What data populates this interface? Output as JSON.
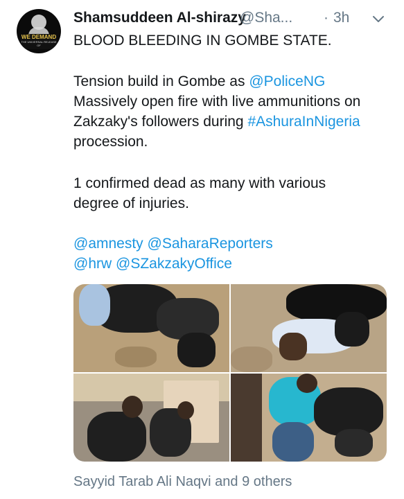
{
  "tweet": {
    "author": {
      "name": "Shamsuddeen Al-shirazy",
      "handle": "@Sha...",
      "avatar_icon": "profile-avatar-icon",
      "avatar_text_main": "WE DEMAND",
      "avatar_text_sub": "THE UNIVERSAL RELEASE OF"
    },
    "separator": "·",
    "time": "3h",
    "menu_icon": "chevron-down-icon",
    "body": {
      "line1": "BLOOD BLEEDING IN GOMBE STATE.",
      "line2_pre": "Tension build in Gombe as ",
      "line2_mention": "@PoliceNG",
      "line3": "Massively open fire with live ammunitions on",
      "line4_pre": "Zakzaky's followers during ",
      "line4_hashtag": "#AshuraInNigeria",
      "line5": "procession.",
      "line6": "1 confirmed dead as many with various",
      "line7": "degree of injuries.",
      "mention_amnesty": "@amnesty",
      "mention_sahara": "@SaharaReporters",
      "mention_hrw": "@hrw",
      "mention_szakzaky": "@SZakzakyOffice"
    },
    "media": {
      "photo_count": 4
    },
    "likes_summary": "Sayyid Tarab Ali Naqvi and 9 others"
  },
  "colors": {
    "text": "#14171a",
    "secondary": "#657786",
    "link": "#1b95e0",
    "background": "#ffffff"
  }
}
